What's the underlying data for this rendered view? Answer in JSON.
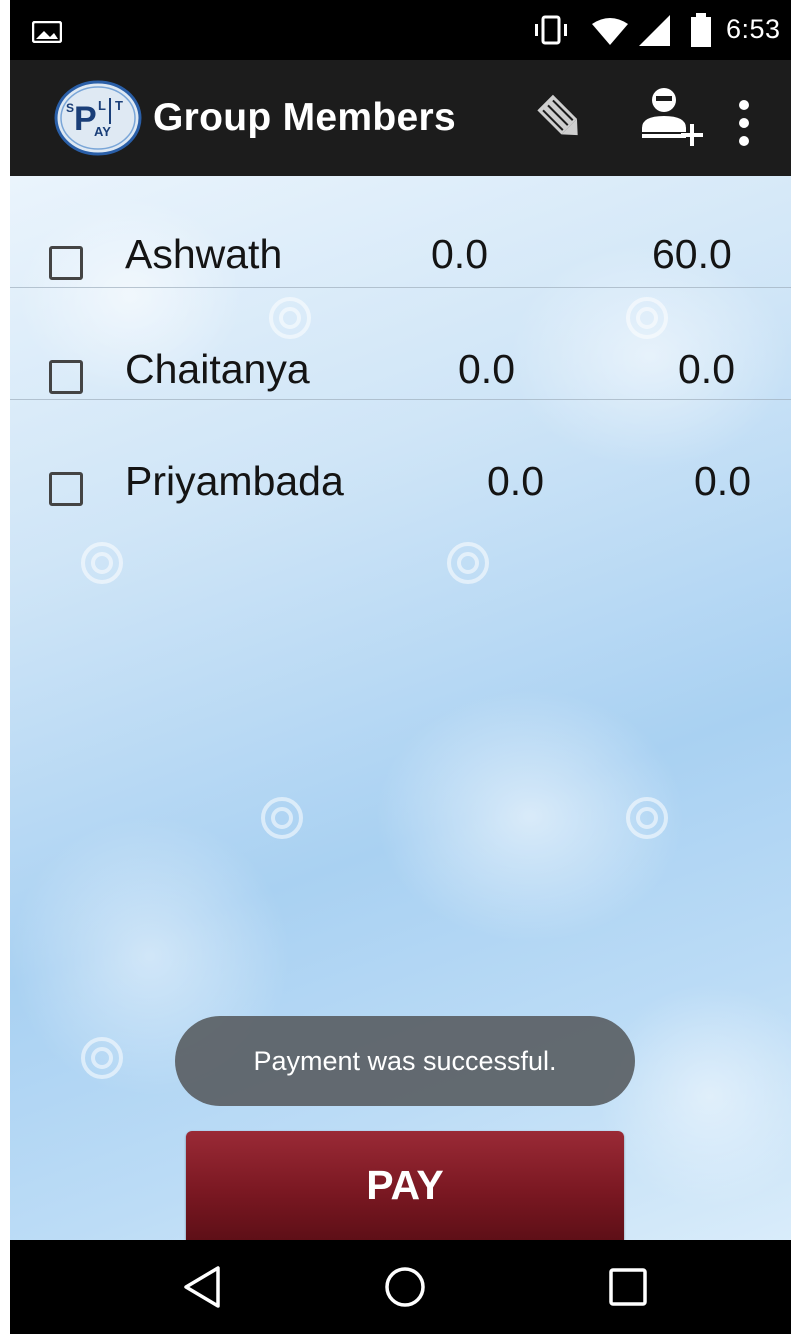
{
  "status_bar": {
    "time": "6:53",
    "icons": [
      "image-notification-icon",
      "vibrate-icon",
      "wifi-icon",
      "signal-icon",
      "battery-icon"
    ]
  },
  "app_bar": {
    "logo_icon": "split-pay-logo",
    "title": "Group Members",
    "actions": [
      "edit-pencil-icon",
      "add-user-icon",
      "more-vert-icon"
    ]
  },
  "members": [
    {
      "name": "Ashwath",
      "value1": "0.0",
      "value2": "60.0",
      "checked": false
    },
    {
      "name": "Chaitanya",
      "value1": "0.0",
      "value2": "0.0",
      "checked": false
    },
    {
      "name": "Priyambada",
      "value1": "0.0",
      "value2": "0.0",
      "checked": false
    }
  ],
  "toast": {
    "message": "Payment was successful."
  },
  "pay_button": {
    "label": "PAY"
  },
  "colors": {
    "pay_button": "#7b1822",
    "app_bar": "#1c1c1c",
    "toast": "#5a6064"
  },
  "nav_bar": {
    "buttons": [
      "back-icon",
      "home-icon",
      "recents-icon"
    ]
  }
}
